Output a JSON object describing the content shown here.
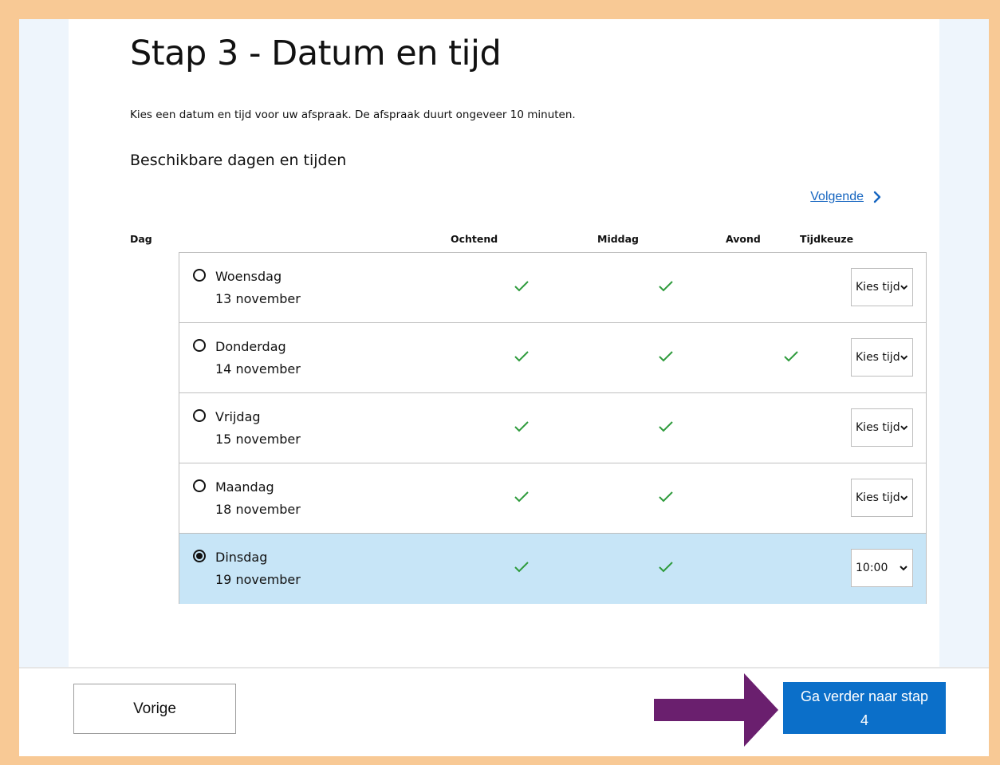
{
  "page": {
    "title": "Stap 3 - Datum en tijd",
    "intro": "Kies een datum en tijd voor uw afspraak. De afspraak duurt ongeveer 10 minuten.",
    "subtitle": "Beschikbare dagen en tijden",
    "next_link": "Volgende"
  },
  "table": {
    "headers": {
      "day": "Dag",
      "morning": "Ochtend",
      "afternoon": "Middag",
      "evening": "Avond",
      "time_choice": "Tijdkeuze"
    },
    "rows": [
      {
        "day": "Woensdag",
        "date": "13 november",
        "morning": true,
        "afternoon": true,
        "evening": false,
        "time": "Kies tijd",
        "selected": false
      },
      {
        "day": "Donderdag",
        "date": "14 november",
        "morning": true,
        "afternoon": true,
        "evening": true,
        "time": "Kies tijd",
        "selected": false
      },
      {
        "day": "Vrijdag",
        "date": "15 november",
        "morning": true,
        "afternoon": true,
        "evening": false,
        "time": "Kies tijd",
        "selected": false
      },
      {
        "day": "Maandag",
        "date": "18 november",
        "morning": true,
        "afternoon": true,
        "evening": false,
        "time": "Kies tijd",
        "selected": false
      },
      {
        "day": "Dinsdag",
        "date": "19 november",
        "morning": true,
        "afternoon": true,
        "evening": false,
        "time": "10:00",
        "selected": true
      }
    ]
  },
  "footer": {
    "prev_label": "Vorige",
    "continue_line1": "Ga verder naar stap",
    "continue_line2": "4"
  },
  "colors": {
    "accent": "#0b6fc9",
    "check": "#2e9b3c",
    "selected_row": "#c7e5f7",
    "annotation_arrow": "#6a1f6e",
    "border_frame": "#f8c995"
  }
}
